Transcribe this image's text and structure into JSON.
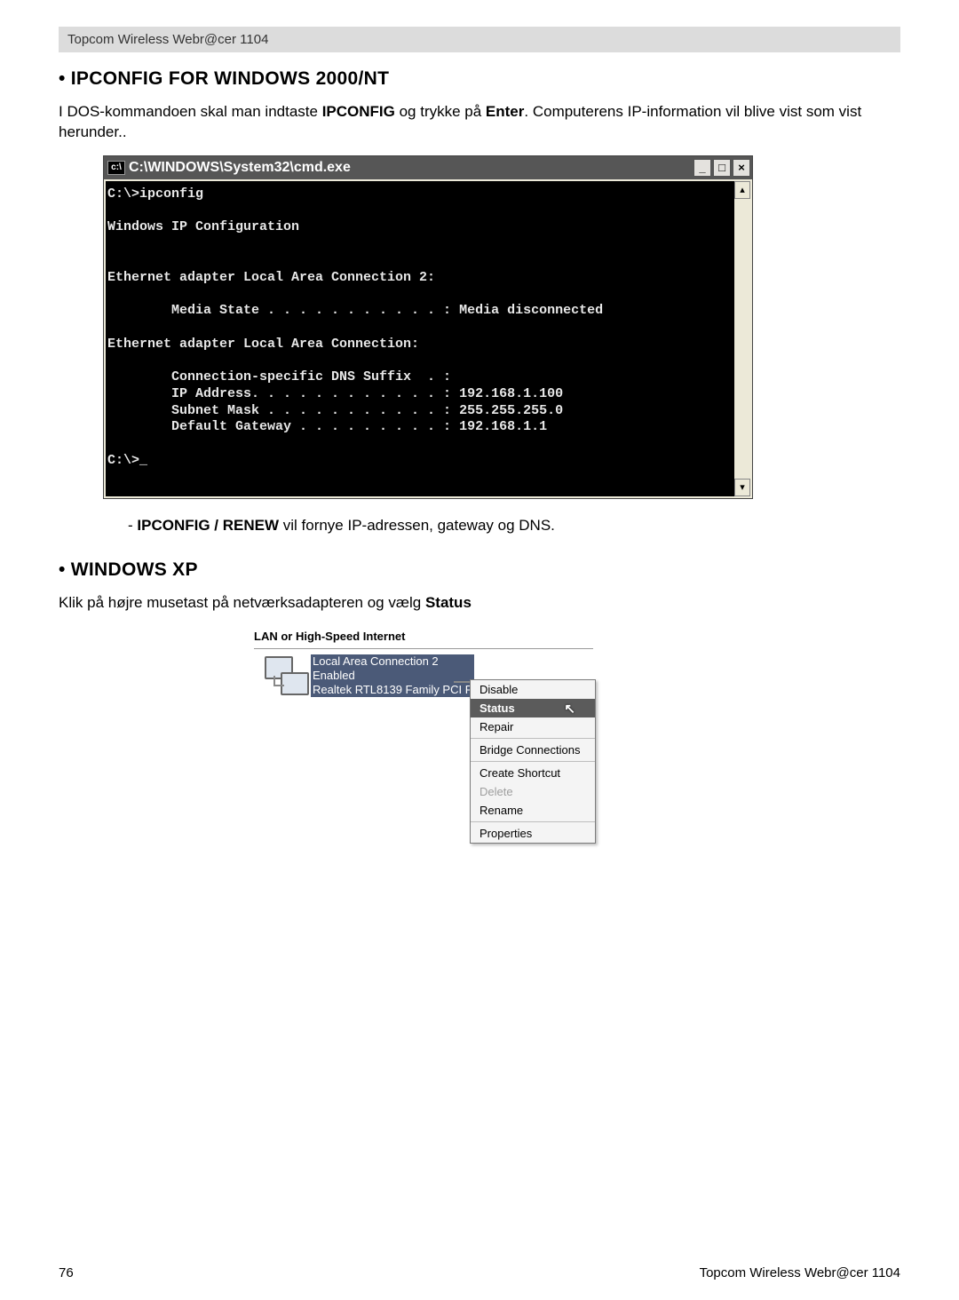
{
  "header_text": "Topcom Wireless Webr@cer 1104",
  "section1": {
    "heading": "• IPCONFIG FOR WINDOWS 2000/NT",
    "body_pre": "I DOS-kommandoen skal man indtaste ",
    "body_bold1": "IPCONFIG",
    "body_mid": " og trykke på ",
    "body_bold2": "Enter",
    "body_post": ". Computerens IP-information vil blive vist som vist herunder.."
  },
  "cmd": {
    "title": "C:\\WINDOWS\\System32\\cmd.exe",
    "icon_text": "c:\\",
    "lines": "C:\\>ipconfig\n\nWindows IP Configuration\n\n\nEthernet adapter Local Area Connection 2:\n\n        Media State . . . . . . . . . . . : Media disconnected\n\nEthernet adapter Local Area Connection:\n\n        Connection-specific DNS Suffix  . :\n        IP Address. . . . . . . . . . . . : 192.168.1.100\n        Subnet Mask . . . . . . . . . . . : 255.255.255.0\n        Default Gateway . . . . . . . . . : 192.168.1.1\n\nC:\\>_"
  },
  "subnote": {
    "dash": "- ",
    "bold": "IPCONFIG / RENEW",
    "rest": " vil fornye IP-adressen, gateway og DNS."
  },
  "section2": {
    "heading": "• WINDOWS XP",
    "body_pre": "Klik på højre musetast på netværksadapteren og vælg ",
    "body_bold": "Status"
  },
  "xp": {
    "group_header": "LAN or High-Speed Internet",
    "conn": {
      "line1": "Local Area Connection 2",
      "line2": "Enabled",
      "line3": "Realtek RTL8139 Family PCI F..."
    },
    "menu": [
      {
        "label": "Disable",
        "state": "normal"
      },
      {
        "label": "Status",
        "state": "selected"
      },
      {
        "label": "Repair",
        "state": "normal"
      },
      {
        "sep": true
      },
      {
        "label": "Bridge Connections",
        "state": "normal"
      },
      {
        "sep": true
      },
      {
        "label": "Create Shortcut",
        "state": "normal"
      },
      {
        "label": "Delete",
        "state": "disabled"
      },
      {
        "label": "Rename",
        "state": "normal"
      },
      {
        "sep": true
      },
      {
        "label": "Properties",
        "state": "normal"
      }
    ]
  },
  "footer": {
    "left": "76",
    "right": "Topcom Wireless Webr@cer 1104"
  }
}
